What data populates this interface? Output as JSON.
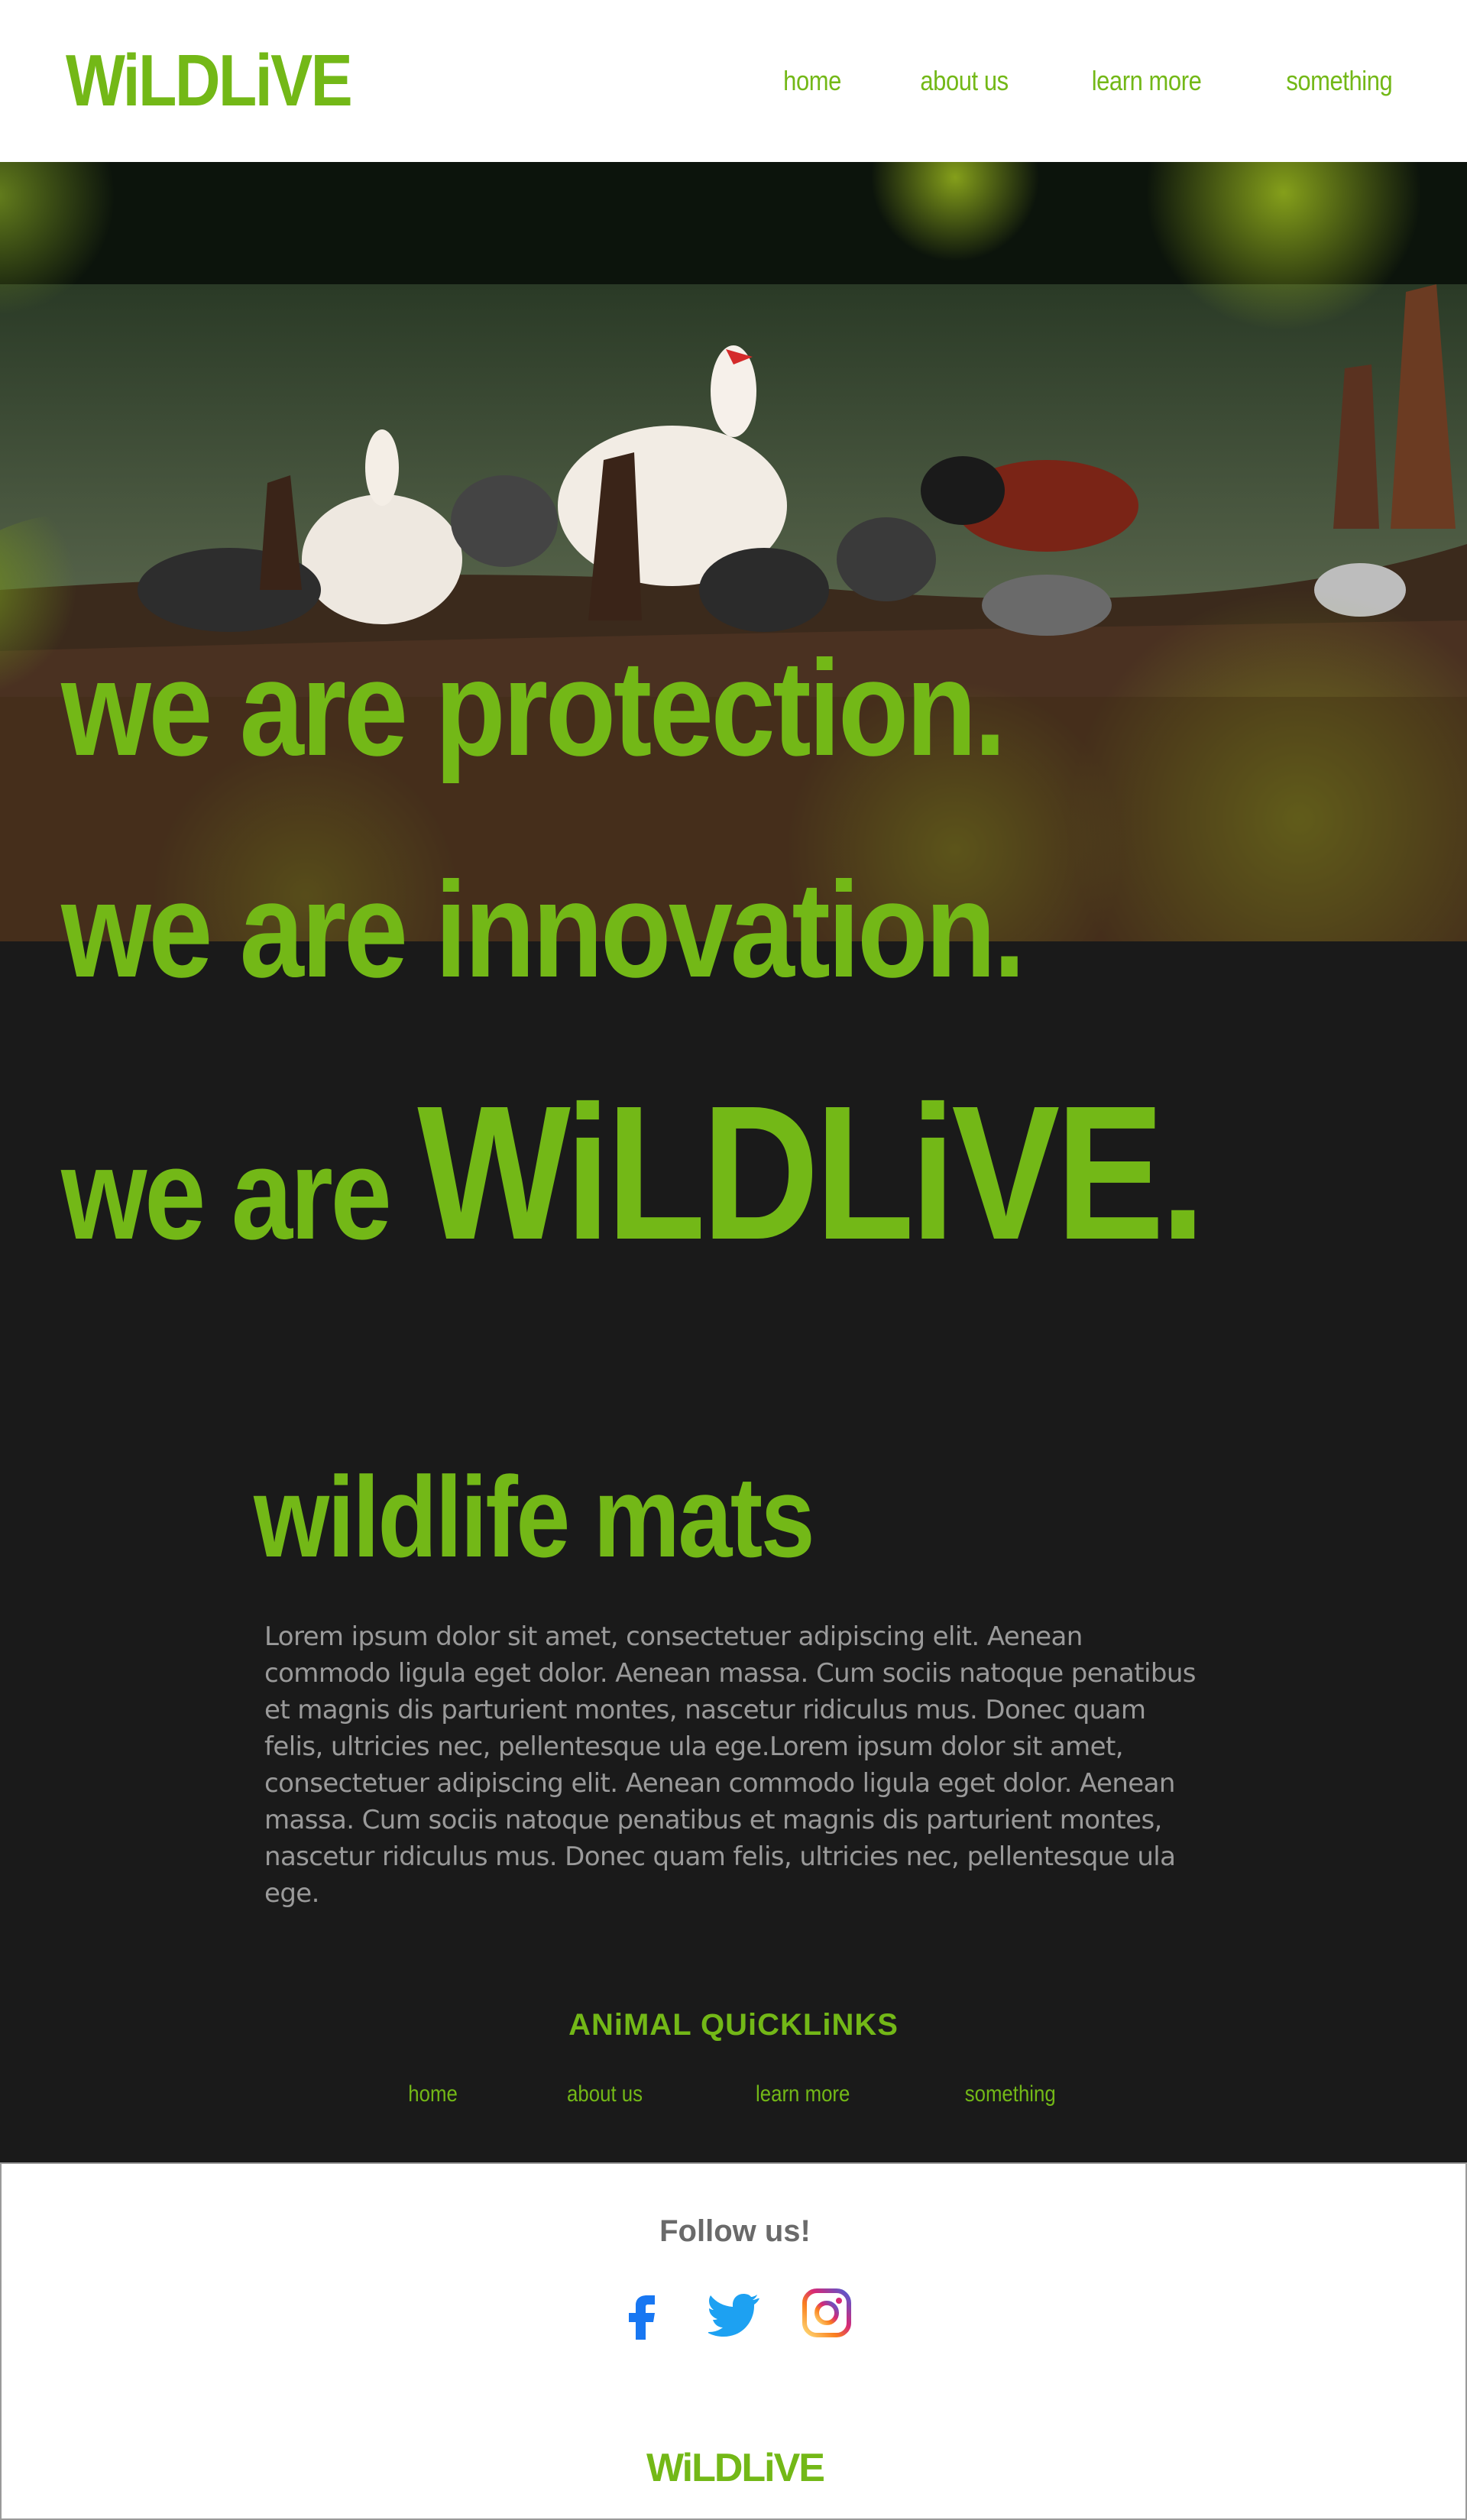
{
  "brand": {
    "logo": "WiLDLiVE",
    "accent_color": "#73b817"
  },
  "nav": {
    "items": [
      {
        "label": "home"
      },
      {
        "label": "about us"
      },
      {
        "label": "learn more"
      },
      {
        "label": "something"
      }
    ]
  },
  "hero": {
    "image_subject": "ducks and geese at a pond",
    "lines": [
      {
        "text": "we are protection."
      },
      {
        "text": "we are innovation."
      }
    ],
    "final_line": {
      "prefix": "we are ",
      "emphasis": "WiLDLiVE."
    }
  },
  "mats": {
    "title": "wildlife mats",
    "body": "Lorem ipsum dolor sit amet, consectetuer adipiscing elit. Aenean commodo ligula eget dolor. Aenean massa. Cum sociis natoque penatibus et magnis dis parturient montes, nascetur ridiculus mus. Donec quam felis, ultricies nec, pellentesque ula ege.Lorem ipsum dolor sit amet, consectetuer adipiscing elit. Aenean commodo ligula eget dolor. Aenean massa. Cum sociis natoque penatibus et magnis dis parturient montes, nascetur ridiculus mus. Donec quam felis, ultricies nec, pellentesque ula ege."
  },
  "quicklinks": {
    "title": "ANiMAL QUiCKLiNKS",
    "items": [
      {
        "label": "home"
      },
      {
        "label": "about us"
      },
      {
        "label": "learn more"
      },
      {
        "label": "something"
      }
    ]
  },
  "footer": {
    "follow_label": "Follow us!",
    "socials": [
      {
        "icon": "facebook-icon",
        "color": "#1877f2"
      },
      {
        "icon": "twitter-icon",
        "color": "#1da1f2"
      },
      {
        "icon": "instagram-icon",
        "color": "#e1306c"
      }
    ],
    "logo": "WiLDLiVE"
  }
}
